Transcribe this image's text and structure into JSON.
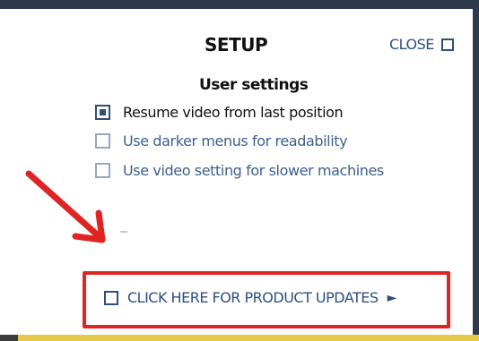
{
  "dialog": {
    "title": "SETUP",
    "close_label": "CLOSE",
    "section_title": "User settings"
  },
  "options": [
    {
      "label": "Resume video from last position",
      "checked": true
    },
    {
      "label": "Use darker menus for readability",
      "checked": false
    },
    {
      "label": "Use video setting for slower machines",
      "checked": false
    }
  ],
  "updates": {
    "label": "CLICK HERE FOR PRODUCT UPDATES",
    "arrow": "►"
  },
  "colors": {
    "accent": "#2e4f7f",
    "annotation_red": "#e02424",
    "frame": "#2e3a4c"
  }
}
